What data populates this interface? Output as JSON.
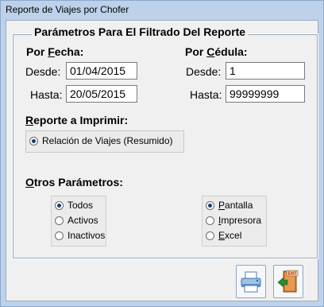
{
  "window": {
    "title": "Reporte de Viajes por Chofer"
  },
  "filters": {
    "group_title": "Parámetros Para El Filtrado Del Reporte",
    "by_date": {
      "label_prefix": "Por ",
      "label_accel": "F",
      "label_rest": "echa:",
      "from_label": "Desde:",
      "from_value": "01/04/2015",
      "to_label": "Hasta:",
      "to_value": "20/05/2015"
    },
    "by_id": {
      "label_prefix": "Por ",
      "label_accel": "C",
      "label_rest": "édula:",
      "from_label": "Desde:",
      "from_value": "1",
      "to_label": "Hasta:",
      "to_value": "99999999"
    }
  },
  "report": {
    "label_accel": "R",
    "label_rest": "eporte a Imprimir:",
    "options": [
      {
        "label": "Relación de Viajes (Resumido)",
        "selected": true
      }
    ]
  },
  "others": {
    "label_accel": "O",
    "label_rest": "tros Parámetros:",
    "status": [
      {
        "label": "Todos",
        "selected": true
      },
      {
        "label": "Activos",
        "selected": false
      },
      {
        "label": "Inactivos",
        "selected": false
      }
    ],
    "output": [
      {
        "accel": "P",
        "rest": "antalla",
        "selected": true
      },
      {
        "accel": "I",
        "rest": "mpresora",
        "selected": false
      },
      {
        "accel": "E",
        "rest": "xcel",
        "selected": false
      }
    ]
  },
  "buttons": {
    "print_icon": "printer-icon",
    "exit_icon": "exit-door-icon",
    "exit_text": "EXIT"
  }
}
